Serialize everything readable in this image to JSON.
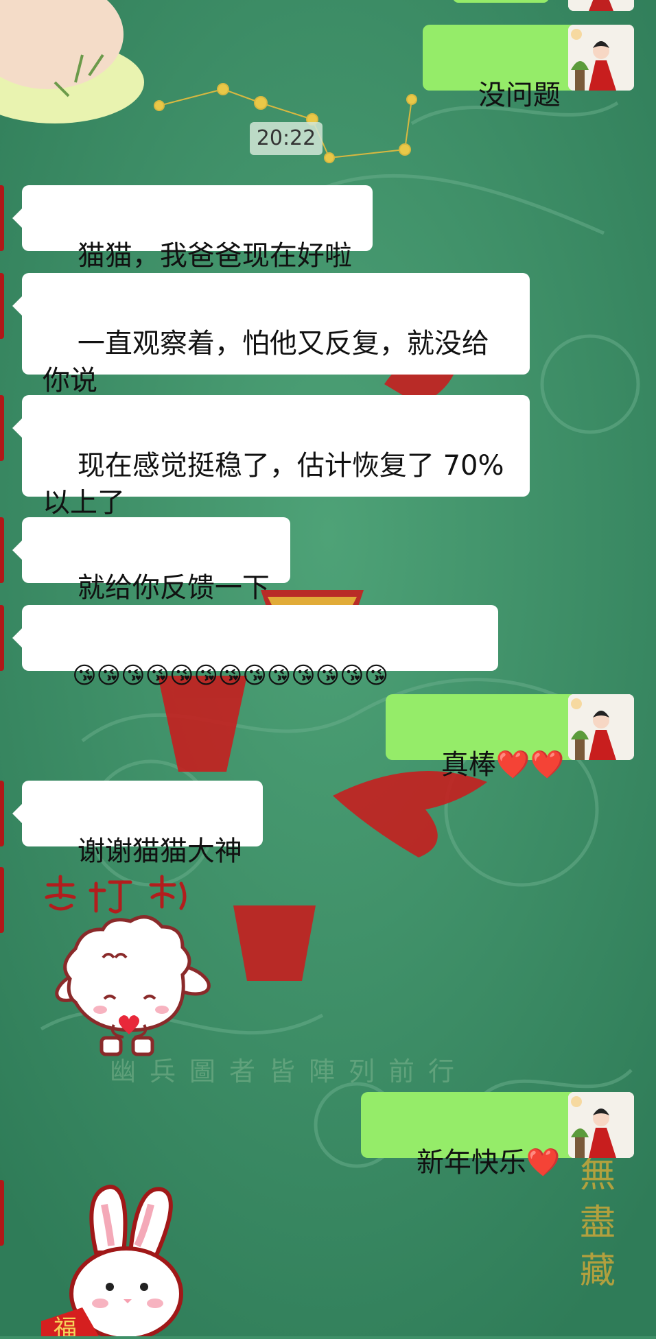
{
  "timestamp": "20:22",
  "messages": [
    {
      "direction": "out",
      "text": "没问题"
    },
    {
      "direction": "in",
      "text": "猫猫，我爸爸现在好啦"
    },
    {
      "direction": "in",
      "text": "一直观察着，怕他又反复，就没给你说"
    },
    {
      "direction": "in",
      "text": "现在感觉挺稳了，估计恢复了 70% 以上了"
    },
    {
      "direction": "in",
      "text": "就给你反馈一下"
    },
    {
      "direction": "in",
      "text": "😘😘😘😘😘😘😘😘😘😘😘😘😘"
    },
    {
      "direction": "out",
      "text": "真棒",
      "emoji": "❤️❤️"
    },
    {
      "direction": "in",
      "text": "谢谢猫猫大神"
    },
    {
      "direction": "in",
      "sticker": "sheep-heart-sticker",
      "sticker_text": "爱你哦"
    },
    {
      "direction": "out",
      "text": "新年快乐",
      "emoji": "❤️"
    },
    {
      "direction": "in",
      "sticker": "rabbit-fu-sticker",
      "sticker_text": "福"
    }
  ],
  "background_text": {
    "caption": "幽兵圖者皆陣列前行",
    "vertical": "無盡藏"
  },
  "colors": {
    "background": "#3f9068",
    "incoming_bubble": "#ffffff",
    "outgoing_bubble": "#95ec69",
    "accent_red": "#c51f1f"
  }
}
